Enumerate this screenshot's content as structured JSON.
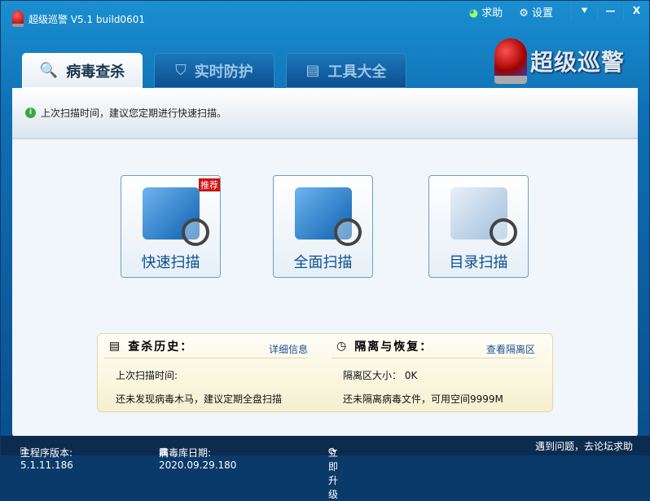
{
  "app": {
    "title": "超级巡警 V5.1 build0601",
    "brand": "超级巡警"
  },
  "top": {
    "help": "求助",
    "settings": "设置",
    "menu": "⯆",
    "minimize": "—",
    "close": "X"
  },
  "tabs": [
    {
      "label": "病毒查杀",
      "icon": "🔍"
    },
    {
      "label": "实时防护",
      "icon": "⛉"
    },
    {
      "label": "工具大全",
      "icon": "▤"
    }
  ],
  "notice": "上次扫描时间，建议您定期进行快速扫描。",
  "scans": [
    {
      "label": "快速扫描",
      "badge": "推荐"
    },
    {
      "label": "全面扫描"
    },
    {
      "label": "目录扫描"
    }
  ],
  "history": {
    "title": "查杀历史：",
    "link": "详细信息",
    "line1": "上次扫描时间:",
    "line2": "还未发现病毒木马，建议定期全盘扫描"
  },
  "quarantine": {
    "title": "隔离与恢复：",
    "link": "查看隔离区",
    "line1": "隔离区大小： 0K",
    "line2": "还未隔离病毒文件，可用空间9999M"
  },
  "status": {
    "version": "主程序版本: 5.1.11.186",
    "db": "病毒库日期: 2020.09.29.180",
    "update": "立即升级",
    "forum": "遇到问题，去论坛求助"
  }
}
